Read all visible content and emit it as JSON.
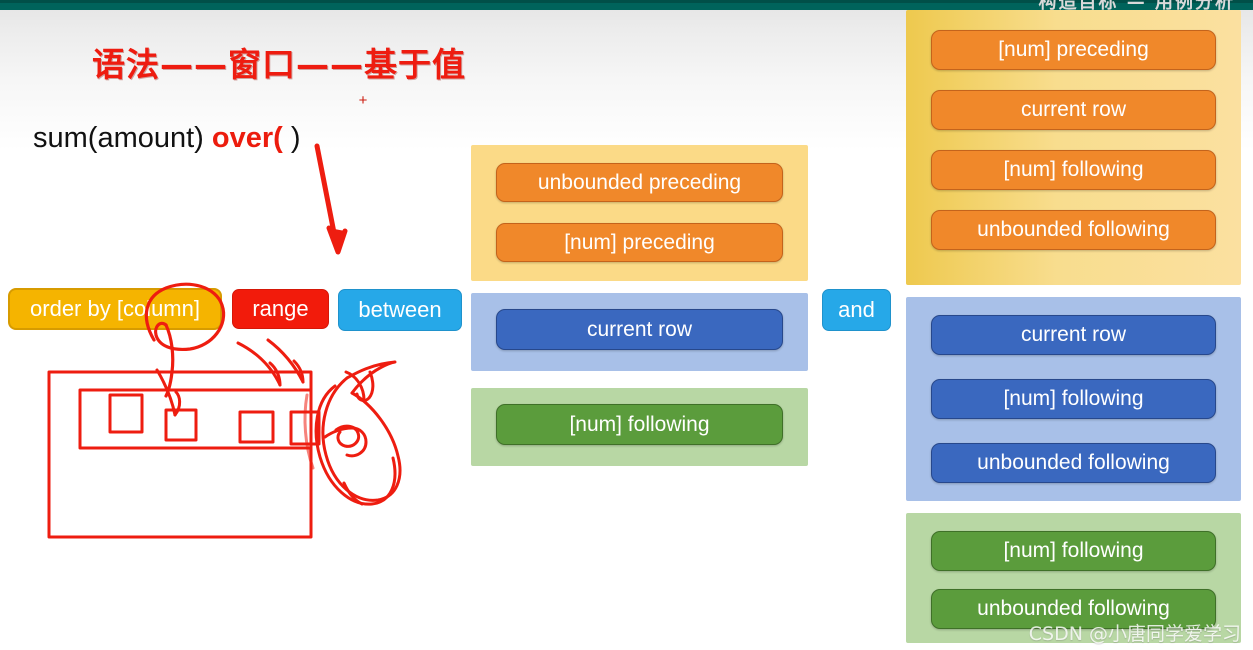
{
  "window": {
    "topbar_title": "构造目标 — 用例分析",
    "topbar_color": "#00635b"
  },
  "slide": {
    "headline": "语法——窗口——基于值",
    "formula": {
      "prefix": "sum(amount) ",
      "keyword": "over(",
      "suffix": " )"
    },
    "plus_mark": "+"
  },
  "buttons": {
    "order_by": "order by [column]",
    "range": "range",
    "between": "between",
    "and": "and"
  },
  "middle_column": {
    "orange_group": {
      "accent": "#f0882a",
      "panel": "#fbda87",
      "options": [
        "unbounded preceding",
        "[num] preceding"
      ]
    },
    "blue_group": {
      "accent": "#3a68bf",
      "panel": "#a8c0e8",
      "options": [
        "current row"
      ]
    },
    "green_group": {
      "accent": "#5b9c3c",
      "panel": "#b8d7a4",
      "options": [
        "[num] following"
      ]
    }
  },
  "right_column": {
    "orange_group": {
      "accent": "#f0882a",
      "panel": "#f3d16a",
      "options": [
        "[num] preceding",
        "current row",
        "[num] following",
        "unbounded following"
      ]
    },
    "blue_group": {
      "accent": "#3a68bf",
      "panel": "#a8c0e8",
      "options": [
        "current row",
        "[num] following",
        "unbounded following"
      ]
    },
    "green_group": {
      "accent": "#5b9c3c",
      "panel": "#b8d7a4",
      "options": [
        "[num] following",
        "unbounded following"
      ]
    }
  },
  "annotations": {
    "ink_color": "#ee1d10",
    "description": "hand-drawn red arrow from over() clause, circle around order by [column], outer rectangle with inner row band containing four small squares, and a scribbled oval at the right"
  },
  "watermark": "CSDN @小唐同学爱学习"
}
